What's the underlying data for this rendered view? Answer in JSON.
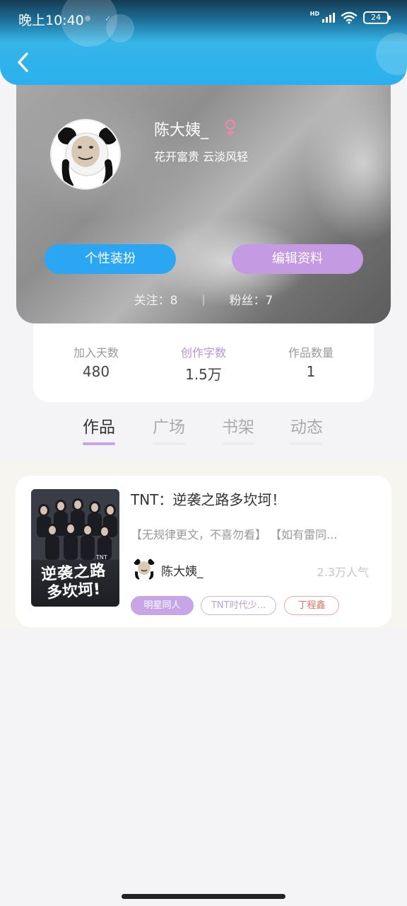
{
  "status_bar": {
    "time": "晚上10:40",
    "network_label": "HD",
    "battery": "24"
  },
  "profile": {
    "nickname": "陈大姨_",
    "gender_icon": "female-icon",
    "signature": "花开富贵   云淡风轻",
    "buttons": {
      "style_label": "个性装扮",
      "edit_label": "编辑资料"
    },
    "follow_text": "关注：8",
    "fans_text": "粉丝：7",
    "separator": "|"
  },
  "stats": [
    {
      "label": "加入天数",
      "value": "480"
    },
    {
      "label": "创作字数",
      "value": "1.5万"
    },
    {
      "label": "作品数量",
      "value": "1"
    }
  ],
  "tabs": [
    {
      "label": "作品",
      "active": true
    },
    {
      "label": "广场",
      "active": false
    },
    {
      "label": "书架",
      "active": false
    },
    {
      "label": "动态",
      "active": false
    }
  ],
  "works": [
    {
      "title": "TNT：逆袭之路多坎坷！",
      "description": "【无规律更文，不喜勿看】  【如有雷同...",
      "author": "陈大姨_",
      "popularity": "2.3万人气",
      "cover": {
        "line1": "逆袭之路",
        "line2": "多坎坷!",
        "badge": "TNT"
      },
      "tags": [
        "明星同人",
        "TNT时代少...",
        "丁程鑫"
      ]
    }
  ],
  "colors": {
    "header": "#2ab0ee",
    "style_button": "#2aa6f3",
    "edit_button": "#c49ae2",
    "tab_indicator": "#c7a7e8",
    "gender_icon": "#e889a8"
  }
}
